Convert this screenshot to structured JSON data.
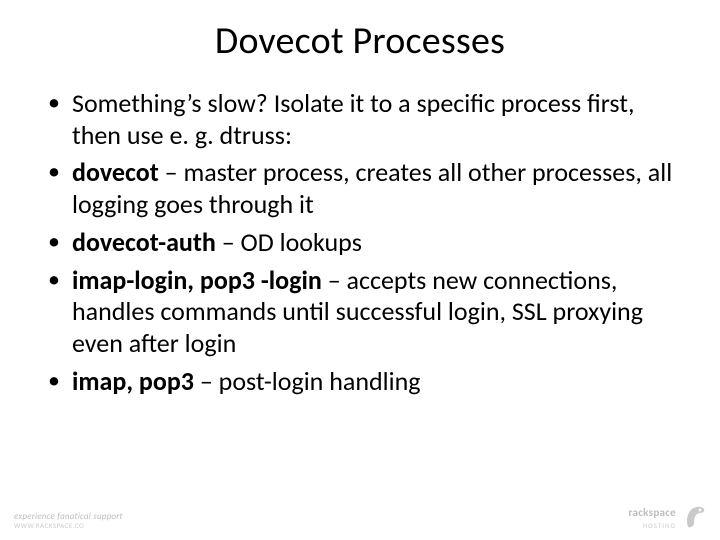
{
  "title": "Dovecot Processes",
  "bullets": {
    "b1": "Something’s slow? Isolate it to a specific process first, then use e. g. dtruss:",
    "b2_bold": "dovecot",
    "b2_rest": " – master process, creates all other processes, all logging goes through it",
    "b3_bold": "dovecot-auth",
    "b3_rest": " – OD lookups",
    "b4_bold": "imap-login, pop3 -login",
    "b4_rest": " – accepts new connections, handles commands until successful login, SSL proxying even after login",
    "b5_bold": "imap, pop3",
    "b5_rest": " – post-login handling"
  },
  "footer": {
    "left_line1": "experience fanatical support",
    "left_line2": "WWW.RACKSPACE.CO",
    "right_brand": "rackspace",
    "right_sub": "HOSTING"
  }
}
